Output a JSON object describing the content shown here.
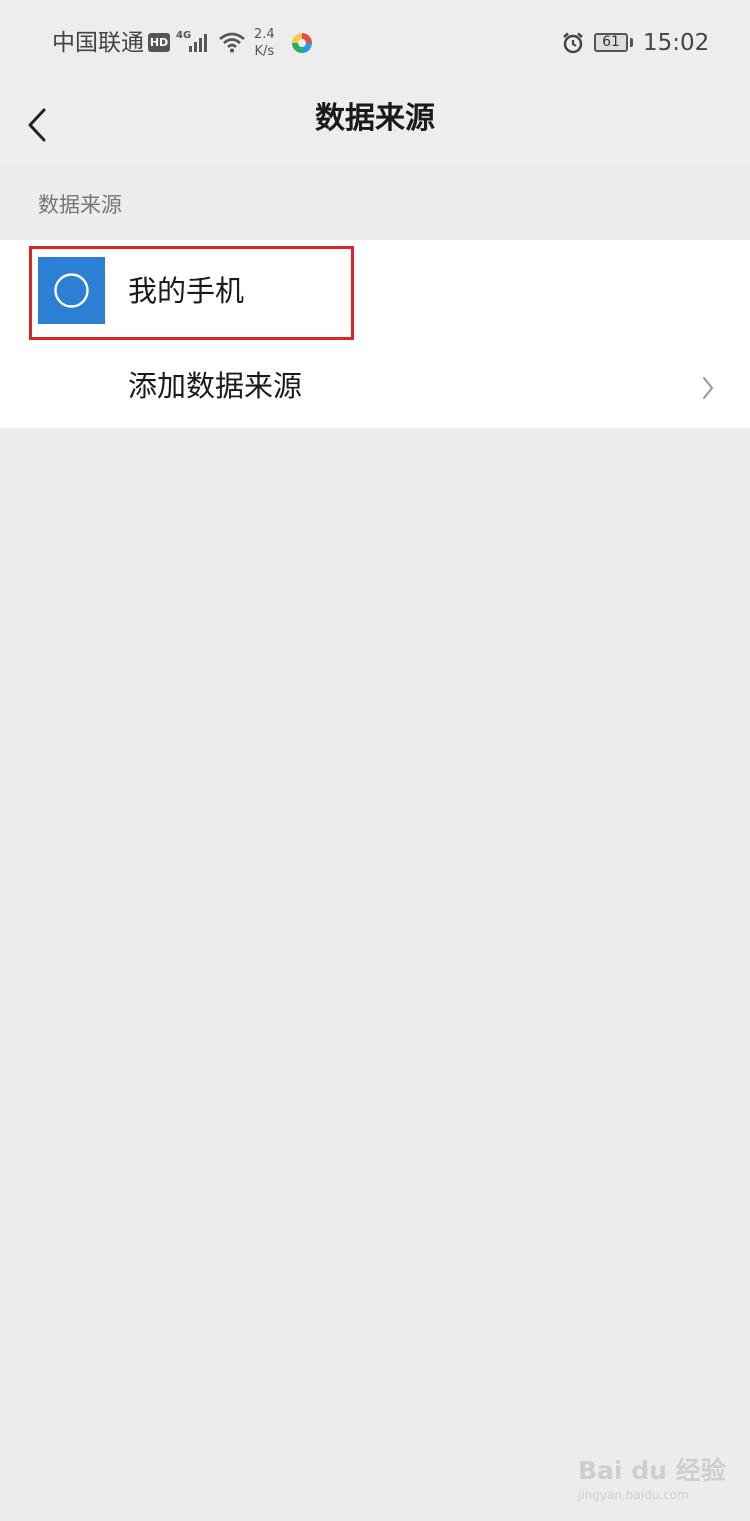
{
  "status_bar": {
    "carrier": "中国联通",
    "hd_badge": "HD",
    "network_type": "4G",
    "speed_value": "2.4",
    "speed_unit": "K/s",
    "battery_level": "61",
    "time": "15:02"
  },
  "nav": {
    "title": "数据来源"
  },
  "section": {
    "header": "数据来源"
  },
  "list": {
    "items": [
      {
        "label": "我的手机",
        "icon": "phone-source-icon"
      },
      {
        "label": "添加数据来源",
        "icon": "chevron-right-icon"
      }
    ]
  },
  "colors": {
    "accent_blue": "#2b7fd4",
    "highlight_red": "#d9262a",
    "background": "#ececec"
  },
  "watermark": {
    "text": "Bai du 经验",
    "url": "jingyan.baidu.com"
  }
}
